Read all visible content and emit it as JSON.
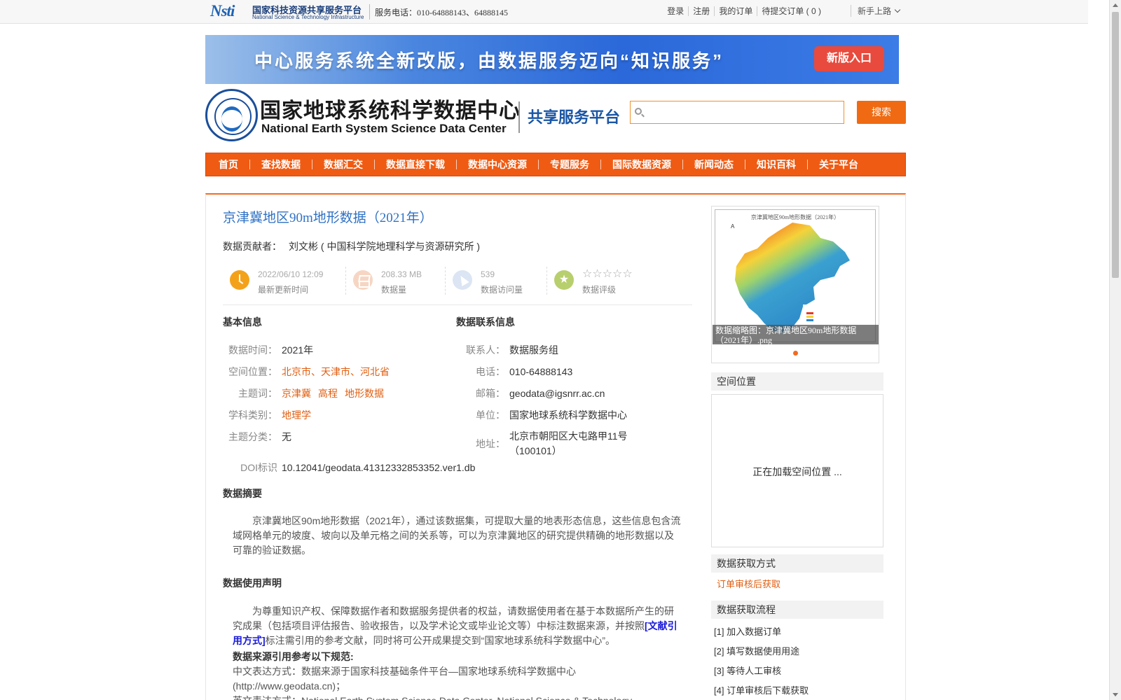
{
  "topbar": {
    "logo_mark": "Nsti",
    "logo_cn": "国家科技资源共享服务平台",
    "logo_en": "National Science & Technology Infrastructure",
    "hotline": "服务电话：010-64888143、64888145",
    "links": [
      "登录",
      "注册",
      "我的订单",
      "待提交订单 ( 0 )"
    ],
    "newbie": "新手上路"
  },
  "banner": {
    "text": "中心服务系统全新改版，由数据服务迈向“知识服务”",
    "button": "新版入口"
  },
  "header": {
    "center_cn": "国家地球系统科学数据中心",
    "center_en": "National Earth System Science Data Center",
    "platform": "共享服务平台",
    "search_placeholder": "",
    "search_button": "搜索"
  },
  "nav": [
    "首页",
    "查找数据",
    "数据汇交",
    "数据直接下载",
    "数据中心资源",
    "专题服务",
    "国际数据资源",
    "新闻动态",
    "知识百科",
    "关于平台"
  ],
  "dataset": {
    "title": "京津冀地区90m地形数据（2021年）",
    "contributor_label": "数据贡献者：",
    "contributor": "刘文彬 ( 中国科学院地理科学与资源研究所 )",
    "stats": [
      {
        "value": "2022/06/10 12:09",
        "label": "最新更新时间",
        "icon": "clock-icon"
      },
      {
        "value": "208.33 MB",
        "label": "数据量",
        "icon": "layers-icon"
      },
      {
        "value": "539",
        "label": "数据访问量",
        "icon": "cursor-icon"
      },
      {
        "value": "☆☆☆☆☆",
        "label": "数据评级",
        "icon": "star-icon"
      }
    ],
    "basic_info_heading": "基本信息",
    "contact_heading": "数据联系信息",
    "basic_info": {
      "time_label": "数据时间：",
      "time": "2021年",
      "location_label": "空间位置：",
      "location": "北京市、天津市、河北省",
      "keywords_label": "主题词：",
      "keywords": [
        "京津冀",
        "高程",
        "地形数据"
      ],
      "discipline_label": "学科类别：",
      "discipline": "地理学",
      "category_label": "主题分类：",
      "category": "无",
      "doi_label": "DOI标识",
      "doi": "10.12041/geodata.41312332853352.ver1.db"
    },
    "contact": {
      "person_label": "联系人：",
      "person": "数据服务组",
      "phone_label": "电话：",
      "phone": "010-64888143",
      "email_label": "邮箱：",
      "email": "geodata@igsnrr.ac.cn",
      "org_label": "单位：",
      "org": "国家地球系统科学数据中心",
      "address_label": "地址：",
      "address_line1": "北京市朝阳区大屯路甲11号",
      "address_line2": "（100101）"
    },
    "abstract_heading": "数据摘要",
    "abstract": "京津冀地区90m地形数据（2021年），通过该数据集，可提取大量的地表形态信息，这些信息包含流域网格单元的坡度、坡向以及单元格之间的关系等，可以为京津冀地区的研究提供精确的地形数据以及可靠的验证数据。",
    "usage_heading": "数据使用声明",
    "usage_text_before": "为尊重知识产权、保障数据作者和数据服务提供者的权益，请数据使用者在基于本数据所产生的研究成果（包括项目评估报告、验收报告，以及学术论文或毕业论文等）中标注数据来源，并按照",
    "usage_cite_link": "[文献引用方式]",
    "usage_text_after": "标注需引用的参考文献，同时将可公开成果提交到“国家地球系统科学数据中心”。",
    "citation_rule": "数据来源引用参考以下规范:",
    "citation_cn": "中文表达方式：数据来源于国家科技基础条件平台—国家地球系统科学数据中心(http://www.geodata.cn)；",
    "citation_en": "英文表达方式：National Earth System Science Data Center, National Science & Technology Infrastructure of China.(http://www.geodata.cn)"
  },
  "sidebar": {
    "thumbnail_title": "京津冀地区90m地形数据（2021年）",
    "thumbnail_caption": "数据缩略图：京津冀地区90m地形数据（2021年）.png",
    "location_heading": "空间位置",
    "location_loading": "正在加载空间位置 ...",
    "access_heading": "数据获取方式",
    "access_method": "订单审核后获取",
    "process_heading": "数据获取流程",
    "steps": [
      "[1] 加入数据订单",
      "[2] 填写数据使用用途",
      "[3] 等待人工审核",
      "[4] 订单审核后下载获取"
    ]
  },
  "colors": {
    "accent": "#ef5b13",
    "link_orange": "#e05e10",
    "title_blue": "#2f72c4"
  }
}
